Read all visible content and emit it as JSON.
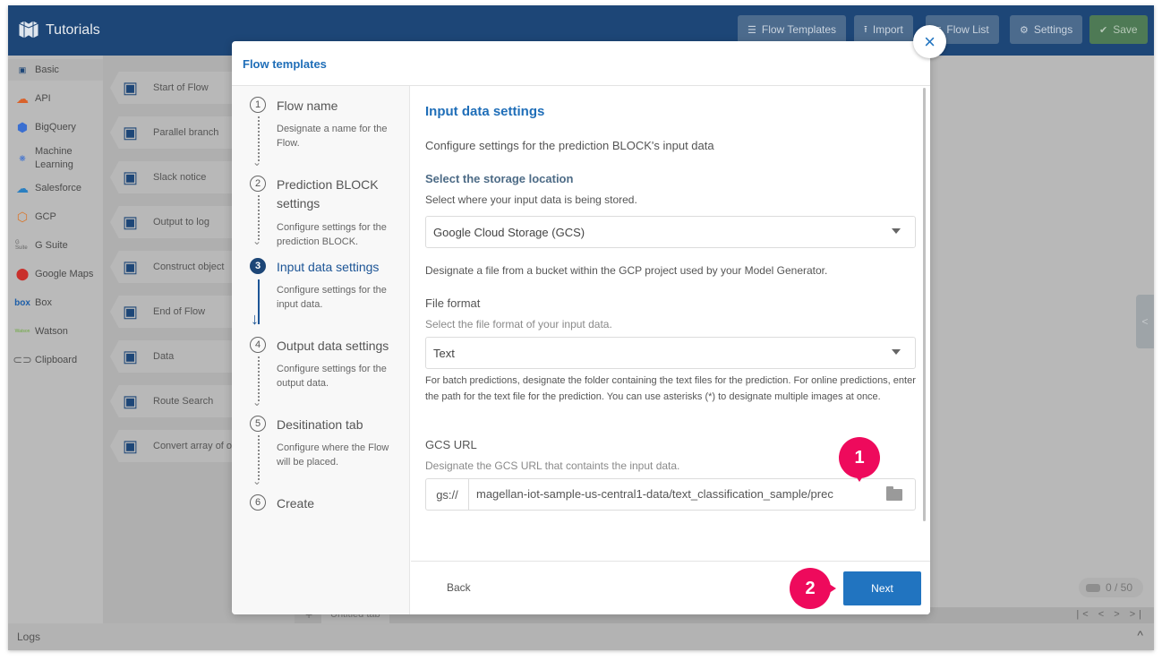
{
  "header": {
    "title": "Tutorials",
    "buttons": [
      {
        "label": "Flow Templates",
        "icon": "list-icon"
      },
      {
        "label": "Import",
        "icon": "upload-icon"
      },
      {
        "label": "Flow List",
        "icon": "menu-icon"
      },
      {
        "label": "Settings",
        "icon": "gear-icon"
      },
      {
        "label": "Save",
        "icon": "check-circle-icon"
      }
    ]
  },
  "sidebar": {
    "categories": [
      {
        "label": "Basic",
        "icon": "magellan-logo-icon"
      },
      {
        "label": "API",
        "icon": "api-cloud-icon"
      },
      {
        "label": "BigQuery",
        "icon": "bigquery-icon"
      },
      {
        "label": "Machine Learning",
        "icon": "brain-icon"
      },
      {
        "label": "Salesforce",
        "icon": "salesforce-cloud-icon"
      },
      {
        "label": "GCP",
        "icon": "gcp-icon"
      },
      {
        "label": "G Suite",
        "icon": "gsuite-icon"
      },
      {
        "label": "Google Maps",
        "icon": "map-pin-icon"
      },
      {
        "label": "Box",
        "icon": "box-logo-icon"
      },
      {
        "label": "Watson",
        "icon": "watson-logo-icon"
      },
      {
        "label": "Clipboard",
        "icon": "paperclip-icon"
      }
    ]
  },
  "palette": {
    "blocks": [
      {
        "label": "Start of Flow"
      },
      {
        "label": "Parallel branch"
      },
      {
        "label": "Slack notice"
      },
      {
        "label": "Output to log"
      },
      {
        "label": "Construct object"
      },
      {
        "label": "End of Flow"
      },
      {
        "label": "Data"
      },
      {
        "label": "Route Search"
      },
      {
        "label": "Convert array of o"
      }
    ]
  },
  "canvas": {
    "counter": "0 / 50",
    "tab_plus": "+",
    "tab_label": "Untitled tab",
    "pager": "|< < > >|",
    "right_toggle": "<"
  },
  "logs": {
    "label": "Logs",
    "toggle": "^"
  },
  "modal": {
    "title": "Flow templates",
    "close": "×",
    "steps": [
      {
        "num": "1",
        "title": "Flow name",
        "desc": "Designate a name for the Flow.",
        "active": false
      },
      {
        "num": "2",
        "title": "Prediction BLOCK settings",
        "desc": "Configure settings for the prediction BLOCK.",
        "active": false
      },
      {
        "num": "3",
        "title": "Input data settings",
        "desc": "Configure settings for the input data.",
        "active": true
      },
      {
        "num": "4",
        "title": "Output data settings",
        "desc": "Configure settings for the output data.",
        "active": false
      },
      {
        "num": "5",
        "title": "Desitination tab",
        "desc": "Configure where the Flow will be placed.",
        "active": false
      },
      {
        "num": "6",
        "title": "Create",
        "desc": "",
        "active": false
      }
    ],
    "content": {
      "title": "Input data settings",
      "subtitle": "Configure settings for the prediction BLOCK's input data",
      "storage_heading": "Select the storage location",
      "storage_note": "Select where your input data is being stored.",
      "storage_value": "Google Cloud Storage (GCS)",
      "bucket_note": "Designate a file from a bucket within the GCP project used by your Model Generator.",
      "format_label": "File format",
      "format_note": "Select the file format of your input data.",
      "format_value": "Text",
      "format_help": "For batch predictions, designate the folder containing the text files for the prediction. For online predictions, enter the path for the text file for the prediction. You can use asterisks (*) to designate multiple images at once.",
      "url_label": "GCS URL",
      "url_note": "Designate the GCS URL that containts the input data.",
      "url_prefix": "gs://",
      "url_value": "magellan-iot-sample-us-central1-data/text_classification_sample/prec"
    },
    "footer": {
      "back": "Back",
      "next": "Next"
    }
  },
  "callouts": [
    {
      "label": "1"
    },
    {
      "label": "2"
    }
  ]
}
